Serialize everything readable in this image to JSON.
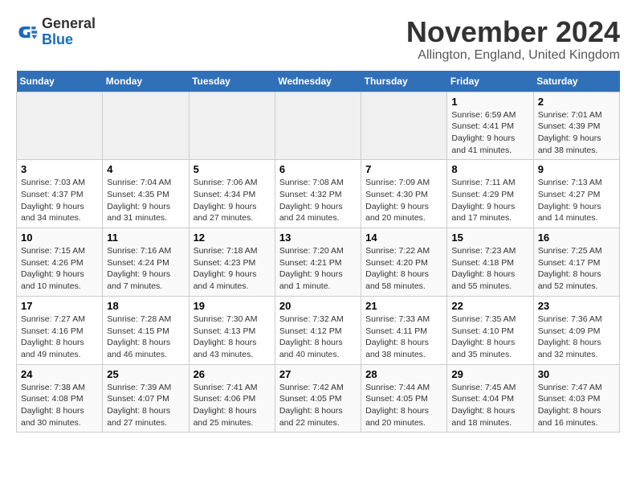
{
  "header": {
    "logo": {
      "line1": "General",
      "line2": "Blue"
    },
    "title": "November 2024",
    "location": "Allington, England, United Kingdom"
  },
  "weekdays": [
    "Sunday",
    "Monday",
    "Tuesday",
    "Wednesday",
    "Thursday",
    "Friday",
    "Saturday"
  ],
  "weeks": [
    [
      {
        "day": "",
        "info": ""
      },
      {
        "day": "",
        "info": ""
      },
      {
        "day": "",
        "info": ""
      },
      {
        "day": "",
        "info": ""
      },
      {
        "day": "",
        "info": ""
      },
      {
        "day": "1",
        "info": "Sunrise: 6:59 AM\nSunset: 4:41 PM\nDaylight: 9 hours\nand 41 minutes."
      },
      {
        "day": "2",
        "info": "Sunrise: 7:01 AM\nSunset: 4:39 PM\nDaylight: 9 hours\nand 38 minutes."
      }
    ],
    [
      {
        "day": "3",
        "info": "Sunrise: 7:03 AM\nSunset: 4:37 PM\nDaylight: 9 hours\nand 34 minutes."
      },
      {
        "day": "4",
        "info": "Sunrise: 7:04 AM\nSunset: 4:35 PM\nDaylight: 9 hours\nand 31 minutes."
      },
      {
        "day": "5",
        "info": "Sunrise: 7:06 AM\nSunset: 4:34 PM\nDaylight: 9 hours\nand 27 minutes."
      },
      {
        "day": "6",
        "info": "Sunrise: 7:08 AM\nSunset: 4:32 PM\nDaylight: 9 hours\nand 24 minutes."
      },
      {
        "day": "7",
        "info": "Sunrise: 7:09 AM\nSunset: 4:30 PM\nDaylight: 9 hours\nand 20 minutes."
      },
      {
        "day": "8",
        "info": "Sunrise: 7:11 AM\nSunset: 4:29 PM\nDaylight: 9 hours\nand 17 minutes."
      },
      {
        "day": "9",
        "info": "Sunrise: 7:13 AM\nSunset: 4:27 PM\nDaylight: 9 hours\nand 14 minutes."
      }
    ],
    [
      {
        "day": "10",
        "info": "Sunrise: 7:15 AM\nSunset: 4:26 PM\nDaylight: 9 hours\nand 10 minutes."
      },
      {
        "day": "11",
        "info": "Sunrise: 7:16 AM\nSunset: 4:24 PM\nDaylight: 9 hours\nand 7 minutes."
      },
      {
        "day": "12",
        "info": "Sunrise: 7:18 AM\nSunset: 4:23 PM\nDaylight: 9 hours\nand 4 minutes."
      },
      {
        "day": "13",
        "info": "Sunrise: 7:20 AM\nSunset: 4:21 PM\nDaylight: 9 hours\nand 1 minute."
      },
      {
        "day": "14",
        "info": "Sunrise: 7:22 AM\nSunset: 4:20 PM\nDaylight: 8 hours\nand 58 minutes."
      },
      {
        "day": "15",
        "info": "Sunrise: 7:23 AM\nSunset: 4:18 PM\nDaylight: 8 hours\nand 55 minutes."
      },
      {
        "day": "16",
        "info": "Sunrise: 7:25 AM\nSunset: 4:17 PM\nDaylight: 8 hours\nand 52 minutes."
      }
    ],
    [
      {
        "day": "17",
        "info": "Sunrise: 7:27 AM\nSunset: 4:16 PM\nDaylight: 8 hours\nand 49 minutes."
      },
      {
        "day": "18",
        "info": "Sunrise: 7:28 AM\nSunset: 4:15 PM\nDaylight: 8 hours\nand 46 minutes."
      },
      {
        "day": "19",
        "info": "Sunrise: 7:30 AM\nSunset: 4:13 PM\nDaylight: 8 hours\nand 43 minutes."
      },
      {
        "day": "20",
        "info": "Sunrise: 7:32 AM\nSunset: 4:12 PM\nDaylight: 8 hours\nand 40 minutes."
      },
      {
        "day": "21",
        "info": "Sunrise: 7:33 AM\nSunset: 4:11 PM\nDaylight: 8 hours\nand 38 minutes."
      },
      {
        "day": "22",
        "info": "Sunrise: 7:35 AM\nSunset: 4:10 PM\nDaylight: 8 hours\nand 35 minutes."
      },
      {
        "day": "23",
        "info": "Sunrise: 7:36 AM\nSunset: 4:09 PM\nDaylight: 8 hours\nand 32 minutes."
      }
    ],
    [
      {
        "day": "24",
        "info": "Sunrise: 7:38 AM\nSunset: 4:08 PM\nDaylight: 8 hours\nand 30 minutes."
      },
      {
        "day": "25",
        "info": "Sunrise: 7:39 AM\nSunset: 4:07 PM\nDaylight: 8 hours\nand 27 minutes."
      },
      {
        "day": "26",
        "info": "Sunrise: 7:41 AM\nSunset: 4:06 PM\nDaylight: 8 hours\nand 25 minutes."
      },
      {
        "day": "27",
        "info": "Sunrise: 7:42 AM\nSunset: 4:05 PM\nDaylight: 8 hours\nand 22 minutes."
      },
      {
        "day": "28",
        "info": "Sunrise: 7:44 AM\nSunset: 4:05 PM\nDaylight: 8 hours\nand 20 minutes."
      },
      {
        "day": "29",
        "info": "Sunrise: 7:45 AM\nSunset: 4:04 PM\nDaylight: 8 hours\nand 18 minutes."
      },
      {
        "day": "30",
        "info": "Sunrise: 7:47 AM\nSunset: 4:03 PM\nDaylight: 8 hours\nand 16 minutes."
      }
    ]
  ]
}
